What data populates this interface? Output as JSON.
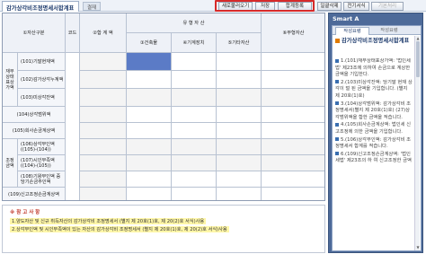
{
  "tabs": {
    "active": "감가상각비조정명세서합계표",
    "other": "결재"
  },
  "toolbar": [
    {
      "label": "새로불러오기",
      "disabled": false
    },
    {
      "label": "저장",
      "disabled": false
    },
    {
      "label": "합계등록",
      "disabled": false
    },
    {
      "label": "일괄삭제",
      "disabled": false
    },
    {
      "label": "전기서식",
      "disabled": false
    },
    {
      "label": "기본처리",
      "disabled": true
    }
  ],
  "table": {
    "h_group": "유 형 자 산",
    "h_item": "①자산구분",
    "h_code": "코드",
    "h_total": "②합 계 액",
    "h_building": "③건축물",
    "h_machine": "④기계장치",
    "h_other": "⑤기타자산",
    "h_intangible": "⑥무형자산",
    "cat1": "재무상태표상가액",
    "cat2": "조정금액",
    "rows": [
      "(101)기말현재액",
      "(102)감가상각누계액",
      "(103)미상각잔액",
      "(104)상각범위액",
      "(105)회사손금계상액",
      "(106)상각부인액 ((105)-(104))",
      "(107)시인부족액 ((104)-(105))",
      "(108)기왕부인액 중 당기손금추인액",
      "(109)신고조정손금계상액"
    ]
  },
  "notes": {
    "title": "※ 참 고 사 항",
    "lines": [
      "1.양도자산 및 신규 취득자산의 감가상각비 조정명세서 (별지 제 20호(1)호, 제 20(2)호 서식)사용",
      "2.상각부인액 및 시인부족액이 있는 자산의 감가상각비 조정명세서 (별지 제 20호(1)호, 제 20(2)호 서식)사용"
    ]
  },
  "right_panel": {
    "title": "Smart A",
    "tabs": [
      "작성요령",
      "작성요령"
    ],
    "header": "감가상각비조정명세서합계표",
    "items": [
      "1.(101)재무상태표상가액: '법인세법' 제23조에 의하여 손금으로 계상한 금액을 기입한다.",
      "2.(103)미상각잔액: 당기말 현재 상각이 덜 된 금액을 기입합니다. (별지 제 20호(1)호)",
      "3.(104)상각범위액: 감가상각비 조정명세서(별지 제 20호(1)호) (27)상각범위액을 합한 금액을 적습니다.",
      "4.(105)회사손금계상액: 법인세 신고조정에 의한 금액을 기입합니다.",
      "5.(106)상각부인액: 감가상각비 조정명세서 합계를 적습니다.",
      "6.(109)신고조정손금계상액: '법인세법' 제23조의 하",
      "여 신고조정한 금액"
    ]
  }
}
